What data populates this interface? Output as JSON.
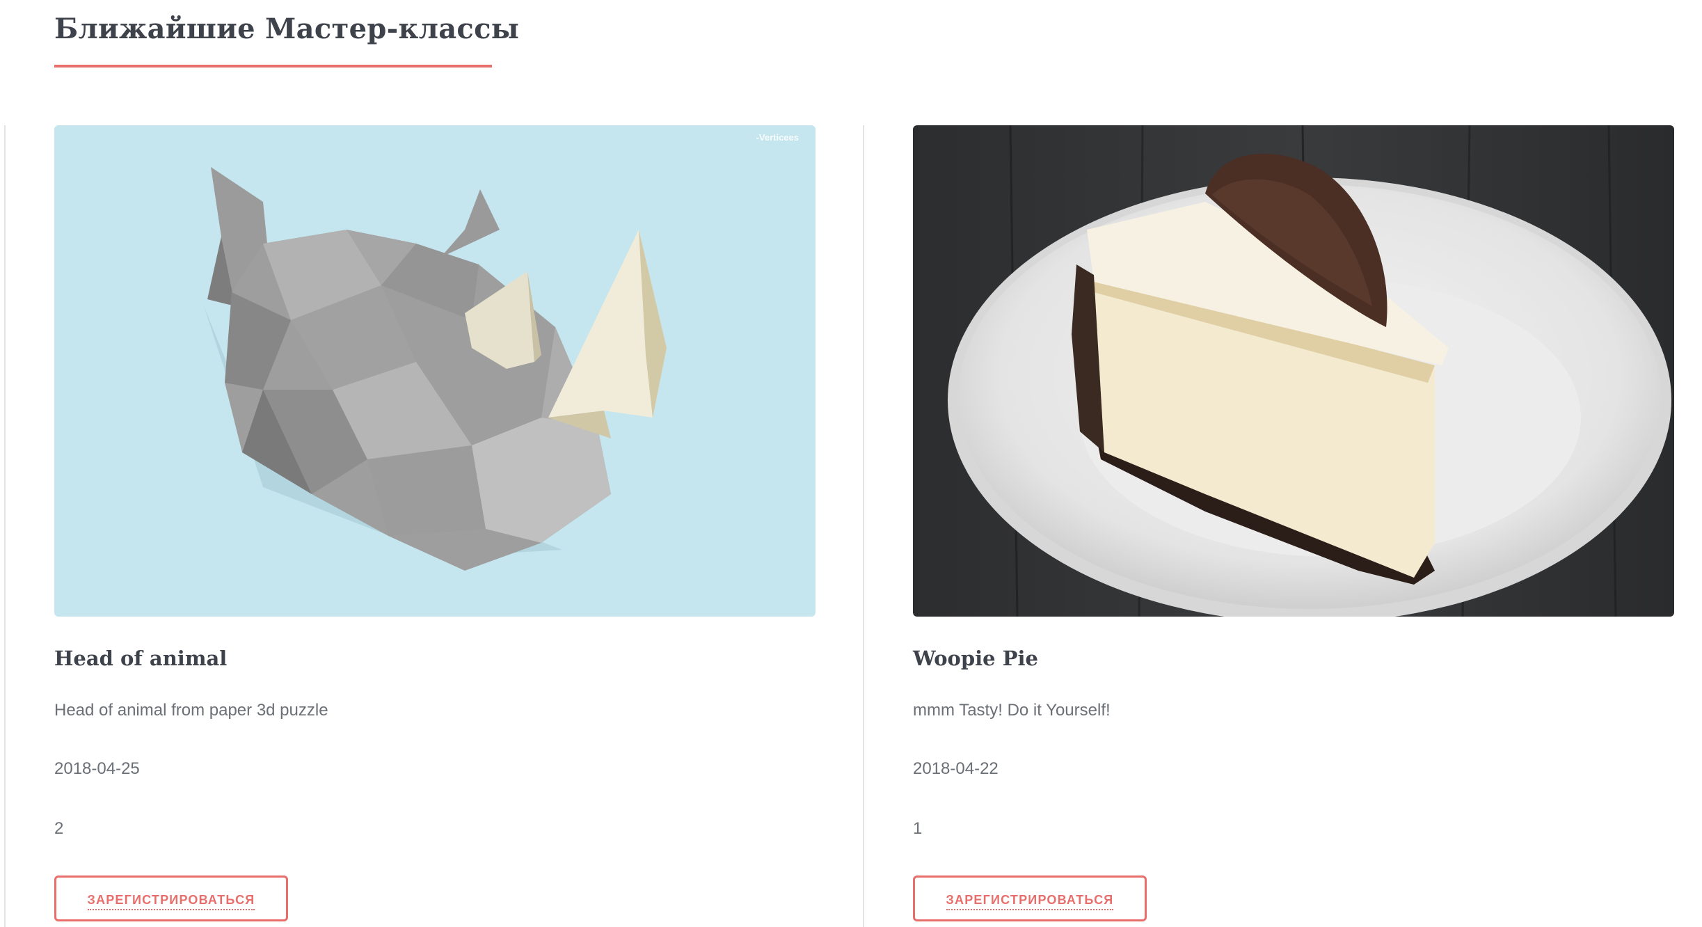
{
  "section": {
    "title": "Ближайшие Мастер-классы"
  },
  "cards": [
    {
      "title": "Head of animal",
      "description": "Head of animal from paper 3d puzzle",
      "date": "2018-04-25",
      "count": "2",
      "button_label": "ЗАРЕГИСТРИРОВАТЬСЯ",
      "image_watermark": "-Verticees",
      "image_subject": "low-poly paper rhino head on light blue wall"
    },
    {
      "title": "Woopie Pie",
      "description": "mmm Tasty! Do it Yourself!",
      "date": "2018-04-22",
      "count": "1",
      "button_label": "ЗАРЕГИСТРИРОВАТЬСЯ",
      "image_subject": "slice of cheesecake on white plate on dark wooden table"
    }
  ],
  "colors": {
    "accent": "#e86e6b",
    "heading": "#3e424b",
    "body_text": "#6b6f76",
    "divider": "#e3e3e3"
  }
}
